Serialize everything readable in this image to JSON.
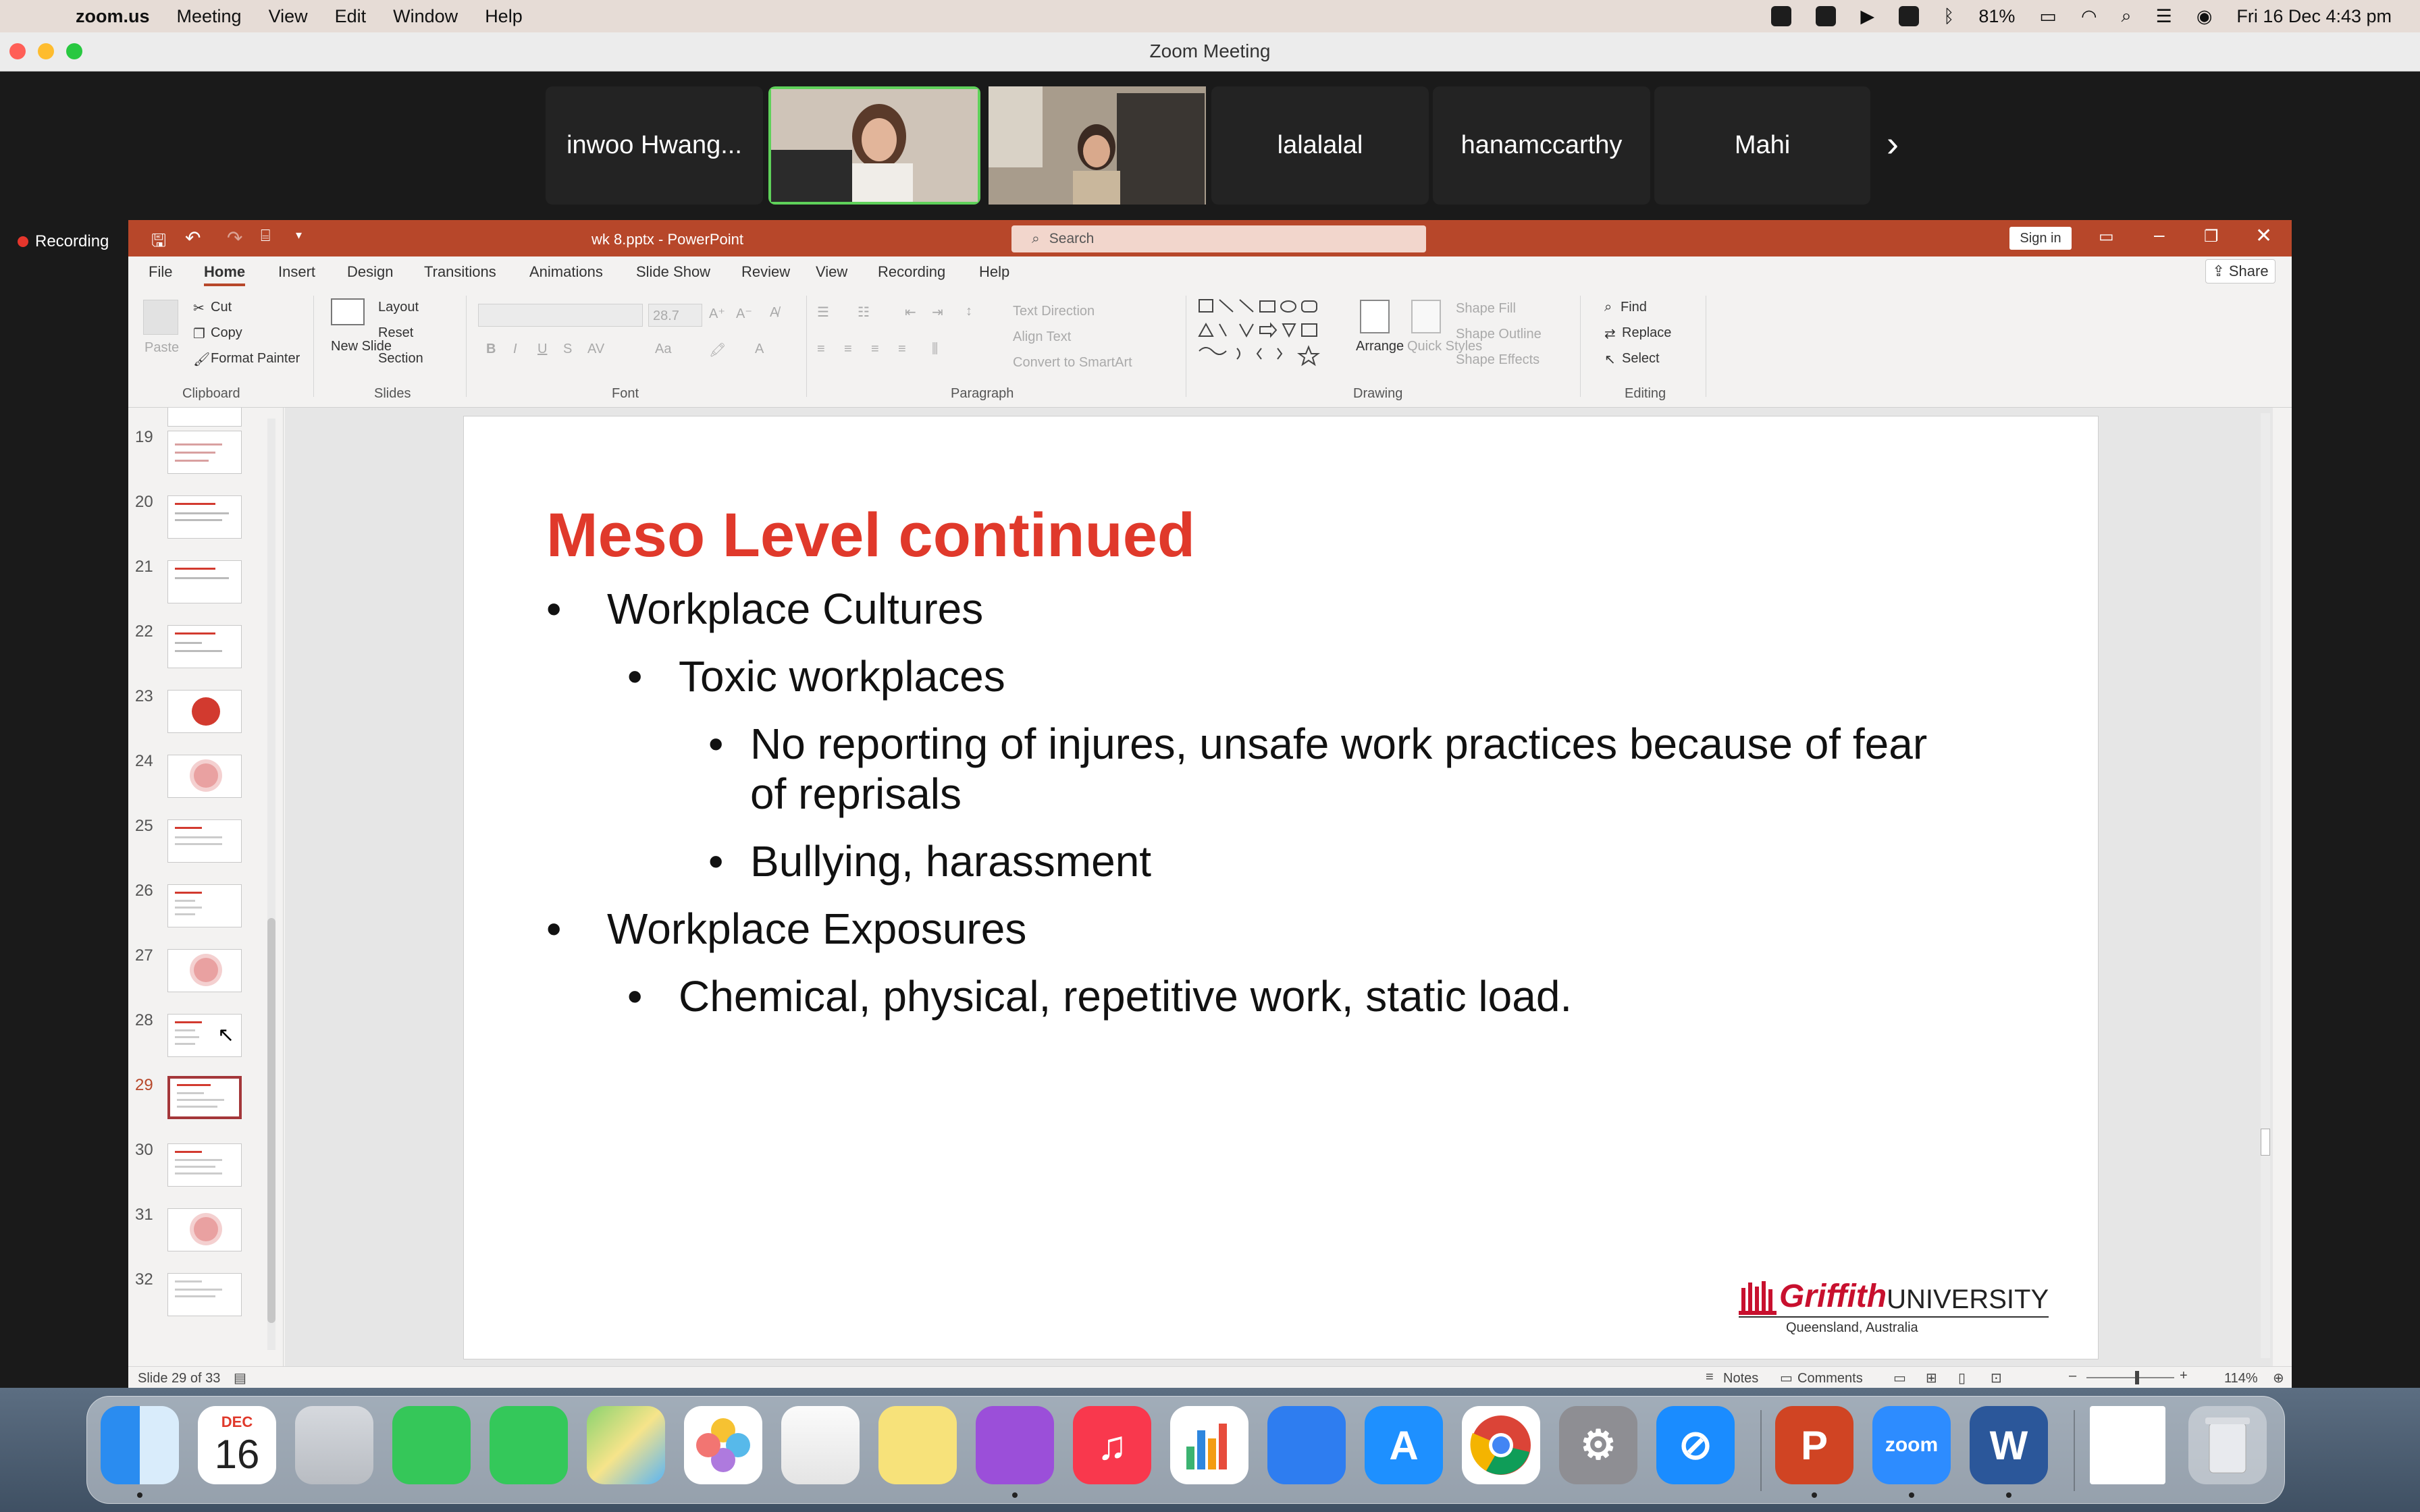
{
  "menubar": {
    "app_name": "zoom.us",
    "items": [
      "Meeting",
      "View",
      "Edit",
      "Window",
      "Help"
    ],
    "battery": "81%",
    "datetime": "Fri 16 Dec  4:43 pm"
  },
  "zoom": {
    "window_title": "Zoom Meeting",
    "recording_label": "Recording",
    "participants": [
      "inwoo Hwang...",
      "lalalalal",
      "hanamccarthy",
      "Mahi"
    ],
    "next_label": "›"
  },
  "ppt": {
    "doc_title": "wk 8.pptx  -  PowerPoint",
    "search_placeholder": "Search",
    "sign_in": "Sign in",
    "share": "Share",
    "tabs": [
      "File",
      "Home",
      "Insert",
      "Design",
      "Transitions",
      "Animations",
      "Slide Show",
      "Review",
      "View",
      "Recording",
      "Help"
    ],
    "ribbon": {
      "paste": "Paste",
      "cut": "Cut",
      "copy": "Copy",
      "format_painter": "Format Painter",
      "clipboard": "Clipboard",
      "new_slide": "New Slide",
      "layout": "Layout",
      "reset": "Reset",
      "section": "Section",
      "slides": "Slides",
      "font_size": "28.7",
      "font": "Font",
      "text_direction": "Text Direction",
      "align_text": "Align Text",
      "convert_smartart": "Convert to SmartArt",
      "paragraph": "Paragraph",
      "arrange": "Arrange",
      "quick_styles": "Quick Styles",
      "shape_fill": "Shape Fill",
      "shape_outline": "Shape Outline",
      "shape_effects": "Shape Effects",
      "drawing": "Drawing",
      "find": "Find",
      "replace": "Replace",
      "select": "Select",
      "editing": "Editing"
    },
    "thumb_numbers": [
      "19",
      "20",
      "21",
      "22",
      "23",
      "24",
      "25",
      "26",
      "27",
      "28",
      "29",
      "30",
      "31",
      "32"
    ],
    "selected_thumb": "29",
    "slide": {
      "title": "Meso Level continued",
      "bullets": [
        {
          "level": 1,
          "text": "Workplace Cultures"
        },
        {
          "level": 2,
          "text": "Toxic workplaces"
        },
        {
          "level": 3,
          "text": "No reporting of injures, unsafe work practices because of fear"
        },
        {
          "level": 3,
          "text": "of reprisals"
        },
        {
          "level": 3,
          "text": "Bullying, harassment"
        },
        {
          "level": 1,
          "text": "Workplace Exposures"
        },
        {
          "level": 2,
          "text": "Chemical, physical, repetitive work, static load."
        }
      ],
      "logo_main": "Griffith",
      "logo_uni": "UNIVERSITY",
      "logo_sub": "Queensland, Australia"
    },
    "status": {
      "slide_count": "Slide 29 of 33",
      "notes": "Notes",
      "comments": "Comments",
      "zoom": "114%"
    }
  },
  "dock": {
    "calendar_month": "DEC",
    "calendar_day": "16",
    "zoom_label": "zoom"
  }
}
